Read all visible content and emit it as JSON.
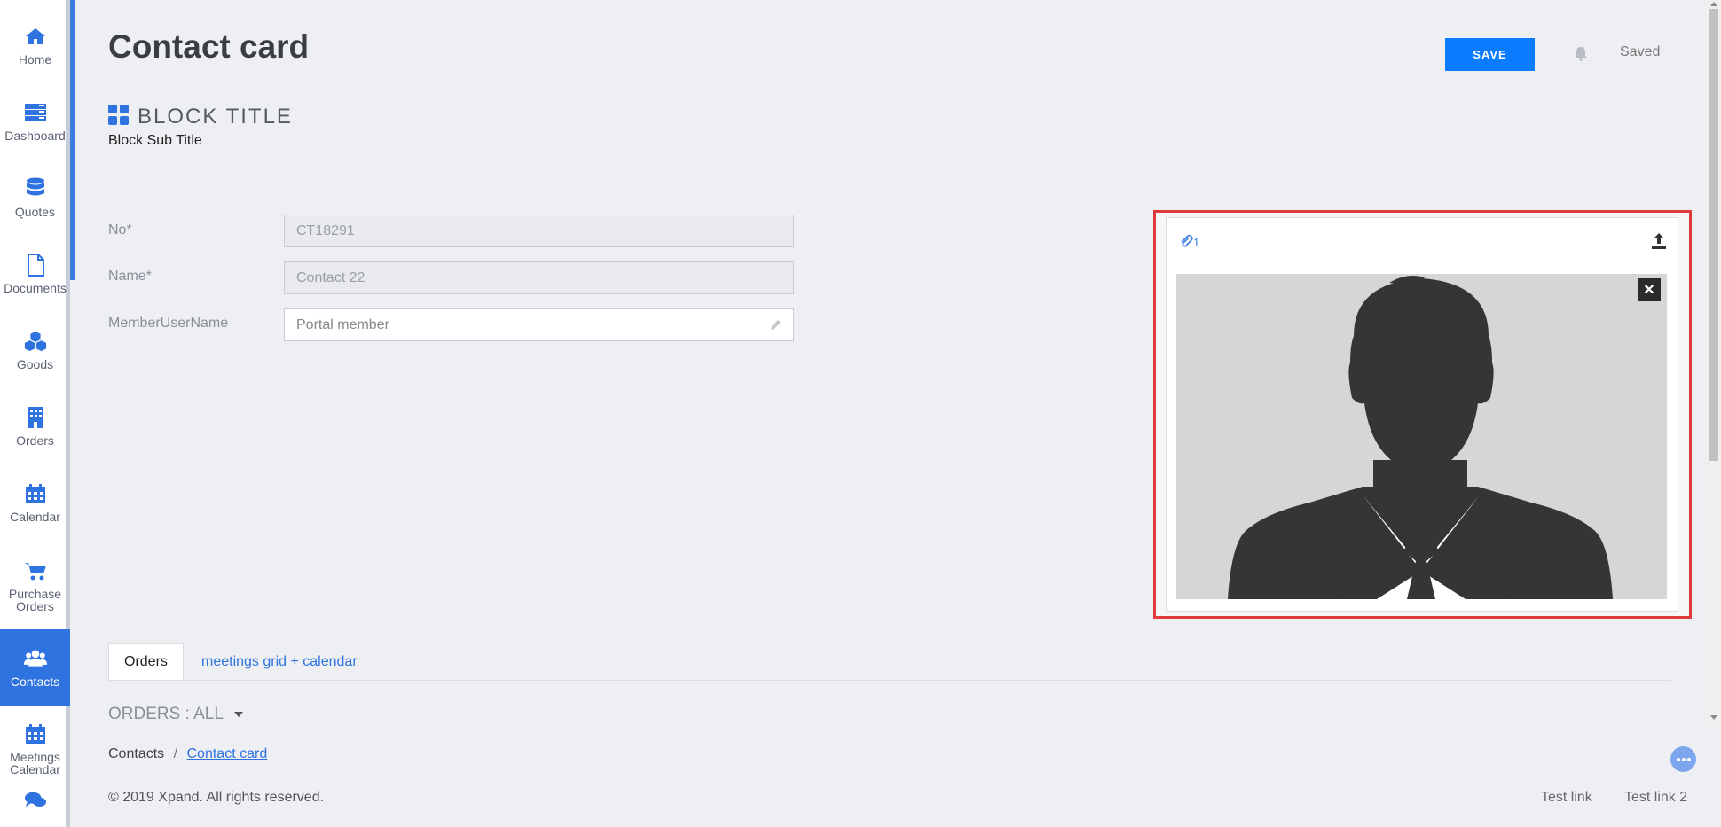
{
  "sidebar": {
    "items": [
      {
        "label": "Home",
        "icon": "home-icon"
      },
      {
        "label": "Dashboard",
        "icon": "dashboard-icon"
      },
      {
        "label": "Quotes",
        "icon": "database-icon"
      },
      {
        "label": "Documents",
        "icon": "document-icon"
      },
      {
        "label": "Goods",
        "icon": "cubes-icon"
      },
      {
        "label": "Orders",
        "icon": "building-icon"
      },
      {
        "label": "Calendar",
        "icon": "calendar-icon"
      },
      {
        "label": "Purchase Orders",
        "icon": "cart-icon"
      },
      {
        "label": "Contacts",
        "icon": "users-icon",
        "active": true
      },
      {
        "label": "Meetings Calendar",
        "icon": "calendar-icon"
      },
      {
        "label": "",
        "icon": "chat-icon"
      }
    ]
  },
  "header": {
    "title": "Contact card",
    "save_label": "SAVE",
    "saved_label": "Saved"
  },
  "block": {
    "title": "BLOCK TITLE",
    "subtitle": "Block Sub Title"
  },
  "fields": {
    "no": {
      "label": "No*",
      "value": "CT18291"
    },
    "name": {
      "label": "Name*",
      "value": "Contact 22"
    },
    "member": {
      "label": "MemberUserName",
      "value": "Portal member"
    }
  },
  "image_card": {
    "attachment_count": "1"
  },
  "tabs": [
    {
      "label": "Orders"
    },
    {
      "label": "meetings grid + calendar"
    }
  ],
  "orders_filter": "ORDERS : ALL",
  "breadcrumb": {
    "parent": "Contacts",
    "separator": "/",
    "current": "Contact card"
  },
  "footer": {
    "copyright": "© 2019 Xpand. All rights reserved.",
    "link1": "Test link",
    "link2": "Test link 2"
  },
  "colors": {
    "accent": "#2f73e0",
    "save_button": "#0a7cff",
    "highlight_border": "#e03b3b"
  }
}
